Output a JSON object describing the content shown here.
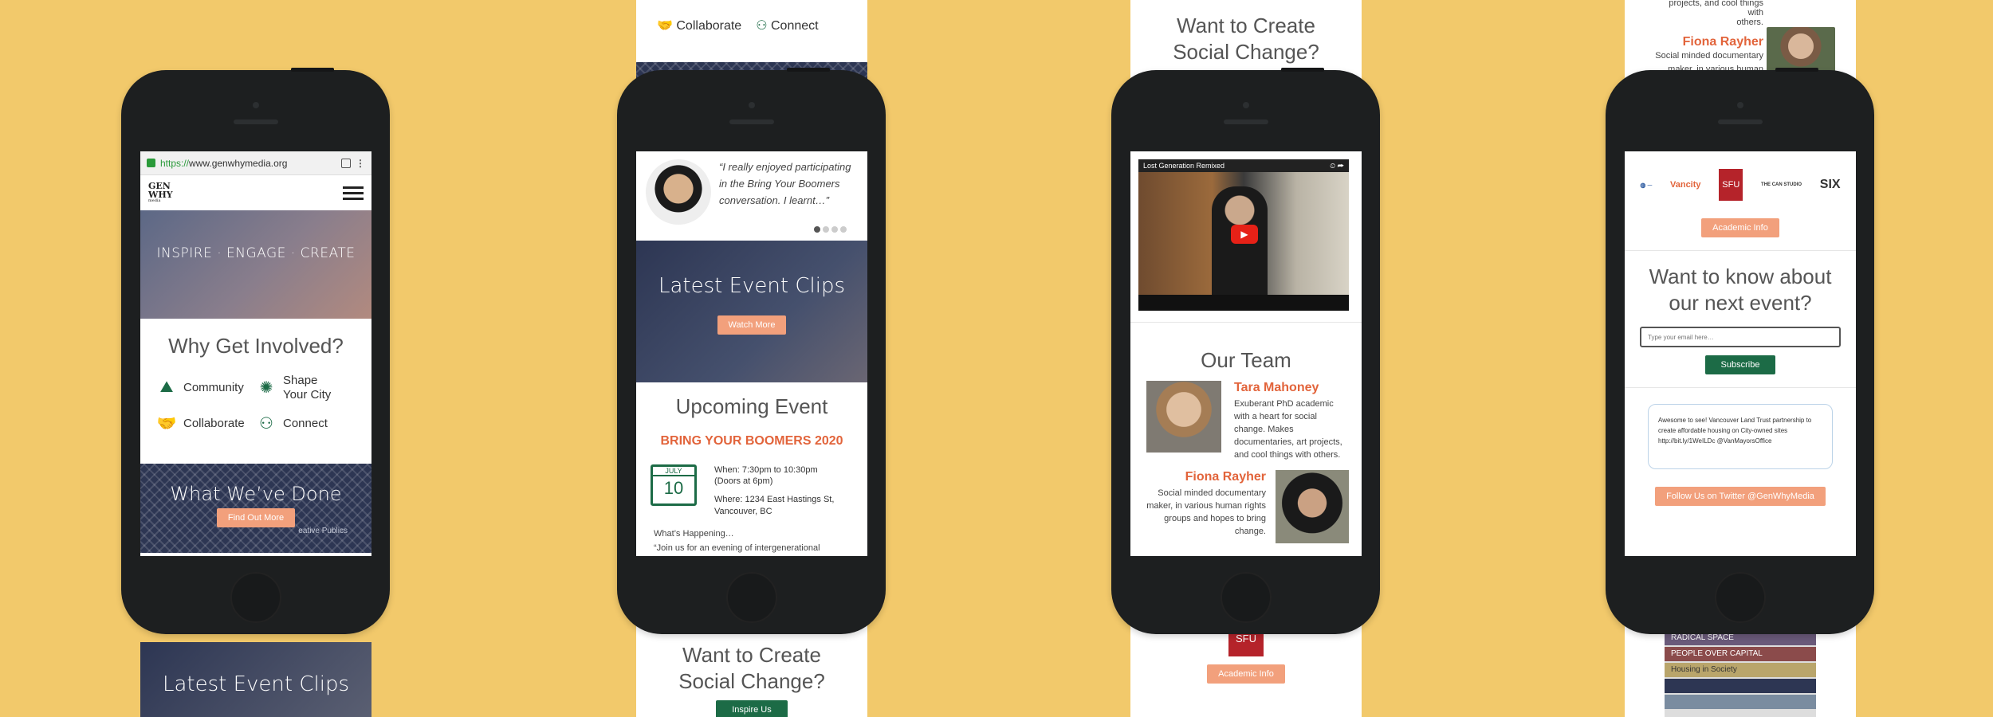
{
  "colors": {
    "background": "#f2c96b",
    "green": "#1c6b46",
    "orange": "#f2a07c",
    "accent": "#e2643b",
    "navy": "#2b3452"
  },
  "browser": {
    "url_prefix": "https://",
    "url": "www.genwhymedia.org"
  },
  "brand": {
    "logo_line1": "GEN",
    "logo_line2": "WHY",
    "logo_line3": "media"
  },
  "hero": {
    "tagline": "INSPIRE · ENGAGE · CREATE"
  },
  "why": {
    "title": "Why Get Involved?",
    "items": [
      {
        "icon": "community-icon",
        "label": "Community"
      },
      {
        "icon": "shape-city-icon",
        "label": "Shape Your City"
      },
      {
        "icon": "collaborate-icon",
        "label": "Collaborate"
      },
      {
        "icon": "connect-icon",
        "label": "Connect"
      }
    ]
  },
  "done": {
    "title": "What We’ve Done",
    "button": "Find Out More",
    "caption": "eative Publics"
  },
  "clips": {
    "title": "Latest Event Clips",
    "button": "Watch More"
  },
  "testimonial": {
    "quote": "“I really enjoyed participating in the Bring Your Boomers conversation. I learnt…”"
  },
  "top_strip2": {
    "partial": "Your City",
    "collab": "Collaborate",
    "connect": "Connect"
  },
  "event": {
    "section_title": "Upcoming Event",
    "name": "BRING YOUR BOOMERS 2020",
    "month": "JULY",
    "day": "10",
    "when_label": "When: 7:30pm to 10:30pm",
    "when_sub": "(Doors at 6pm)",
    "where_label": "Where: 1234 East Hastings St,",
    "where_sub": "Vancouver, BC",
    "happening": "What’s Happening…",
    "desc": "“Join us for an evening of intergenerational dialogue around activism and social change. With"
  },
  "change": {
    "title": "Want to Create Social Change?",
    "button": "Inspire Us"
  },
  "video": {
    "title": "Lost Generation Remixed"
  },
  "team": {
    "title": "Our Team",
    "members": [
      {
        "name": "Tara Mahoney",
        "bio": "Exuberant PhD academic with a heart for social change. Makes documentaries, art projects, and cool things with others."
      },
      {
        "name": "Fiona Rayher",
        "bio": "Social minded documentary maker, in various human rights groups and hopes to bring change."
      }
    ]
  },
  "top_strip4": {
    "partial1": "projects, and cool things with",
    "partial2": "others.",
    "name": "Fiona Rayher",
    "bio": "Social minded documentary maker, in various human"
  },
  "partners": {
    "logos": [
      "Vancity",
      "SFU",
      "THE CAN STUDIO",
      "SIX"
    ],
    "button": "Academic Info"
  },
  "newsletter": {
    "title": "Want to know about our next event?",
    "placeholder": "Type your email here…",
    "button": "Subscribe"
  },
  "tweet": {
    "text": "Awesome to see! Vancouver Land Trust partnership to create affordable housing on City-owned sites http://bit.ly/1WeILDc @VanMayorsOffice",
    "button": "Follow Us on Twitter @GenWhyMedia"
  },
  "books": [
    "RADICAL SPACE",
    "PEOPLE OVER CAPITAL",
    "Housing in Society"
  ]
}
